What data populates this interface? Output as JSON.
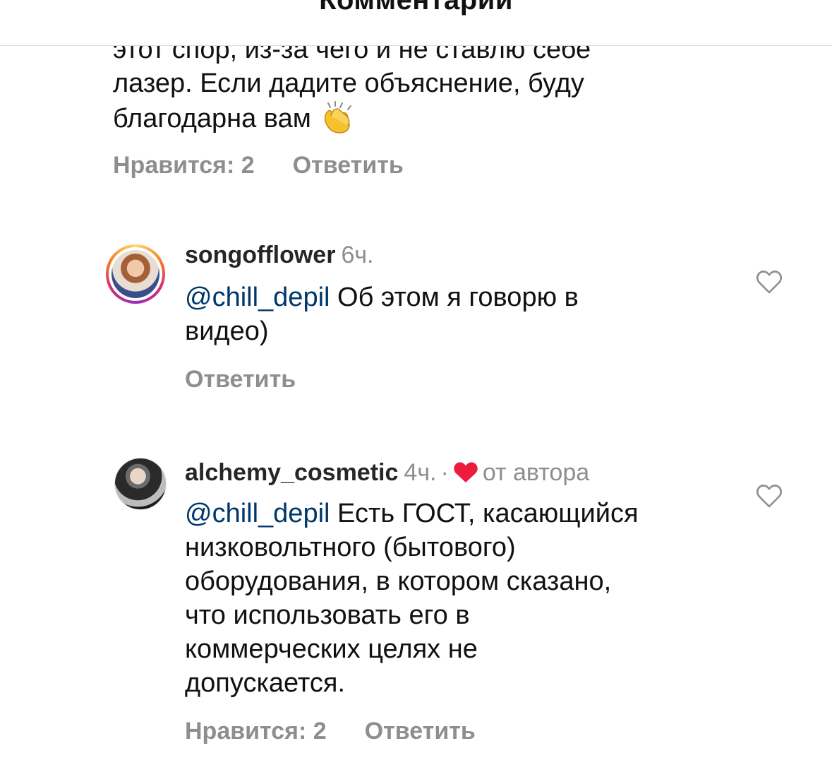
{
  "header": {
    "title": "Комментарии"
  },
  "comments": [
    {
      "text_lines": [
        "этот спор, из-за чего и не ставлю себе",
        "лазер. Если дадите объяснение, буду",
        "благодарна вам"
      ],
      "emoji_icon": "clapping-hands-icon",
      "likes_label": "Нравится: 2",
      "reply_label": "Ответить"
    },
    {
      "username": "songofflower",
      "time": "6ч.",
      "mention": "@chill_depil",
      "text_line1": " Об этом я говорю в",
      "text_line2": "видео)",
      "reply_label": "Ответить",
      "avatar_ring": "story-gradient",
      "like_icon": "heart-outline-icon"
    },
    {
      "username": "alchemy_cosmetic",
      "time": "4ч.",
      "separator": "·",
      "author_badge": "от автора",
      "author_heart_color": "#ed1c3d",
      "mention": "@chill_depil",
      "text_line1": " Есть ГОСТ, касающийся",
      "text_lines": [
        "низковольтного (бытового)",
        "оборудования, в котором сказано,",
        "что использовать его в",
        "коммерческих целях не",
        "допускается."
      ],
      "likes_label": "Нравится: 2",
      "reply_label": "Ответить",
      "like_icon": "heart-outline-icon"
    }
  ],
  "colors": {
    "mention": "#00376b",
    "secondary_text": "#8e8e8e",
    "primary_text": "#111111"
  }
}
